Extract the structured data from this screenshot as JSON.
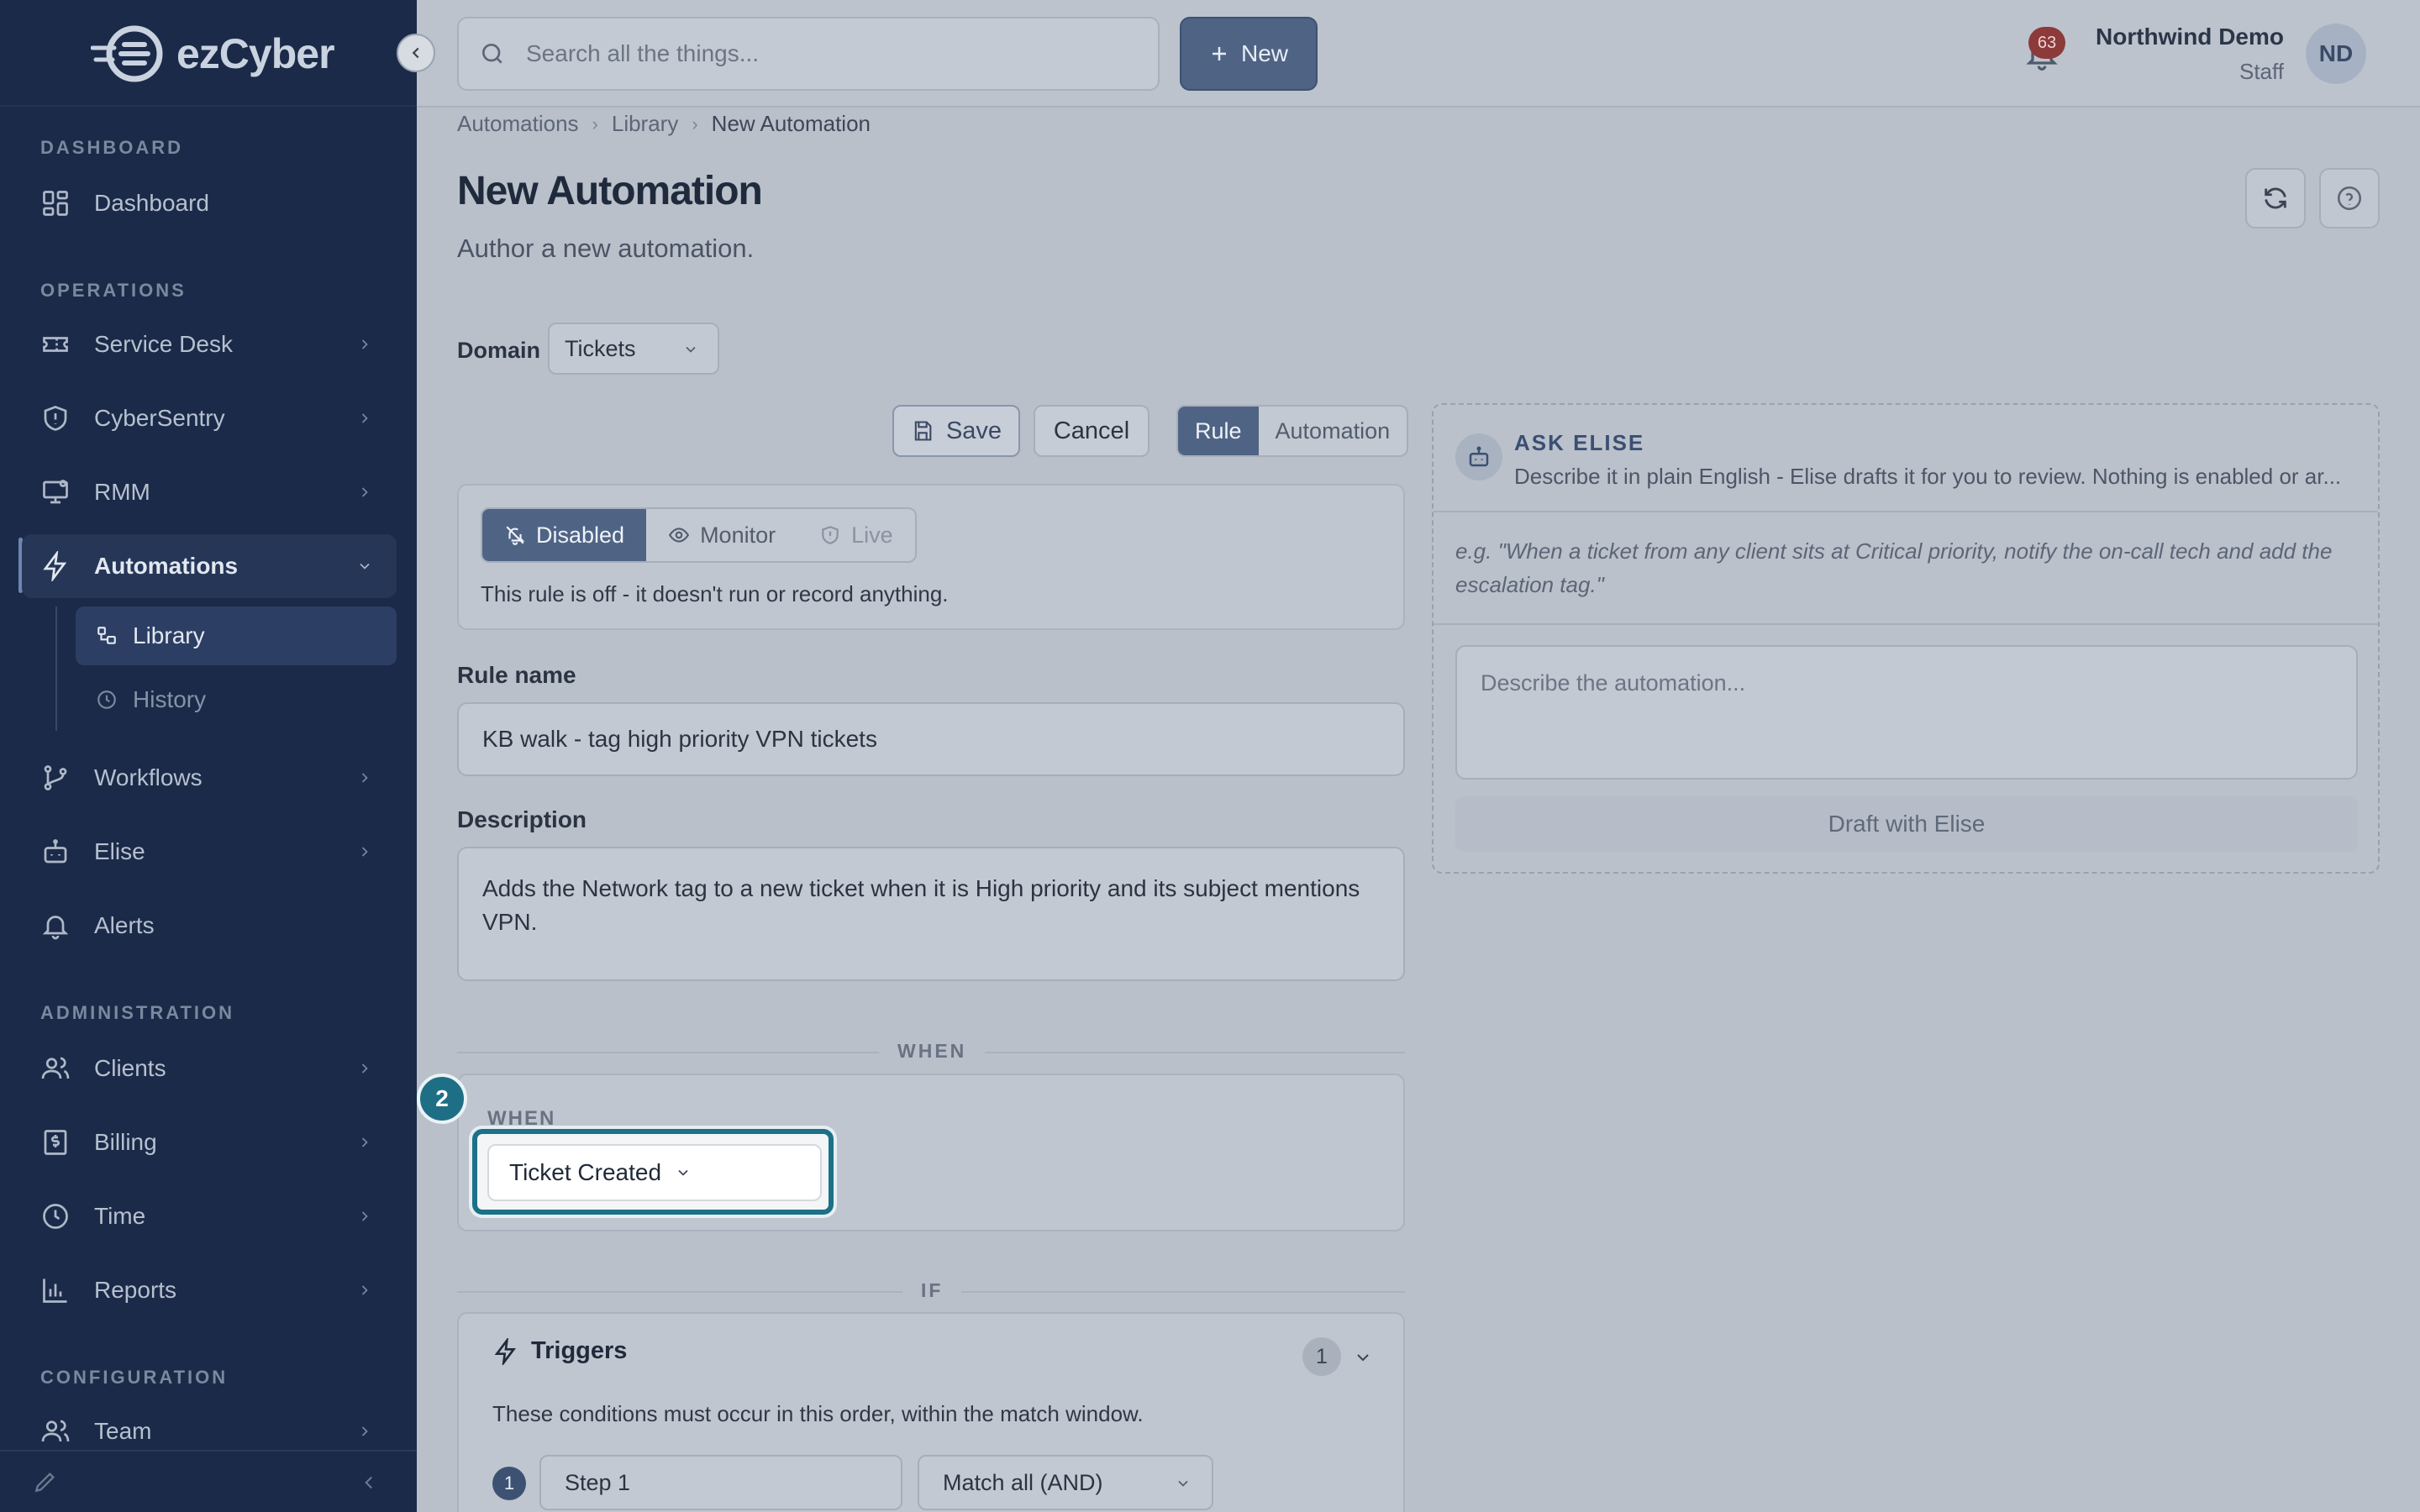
{
  "app": {
    "logo_text": "ezCyber"
  },
  "sidebar": {
    "sections": {
      "dashboard": "DASHBOARD",
      "operations": "OPERATIONS",
      "administration": "ADMINISTRATION",
      "configuration": "CONFIGURATION"
    },
    "items": {
      "dashboard": "Dashboard",
      "service_desk": "Service Desk",
      "cybersentry": "CyberSentry",
      "rmm": "RMM",
      "automations": "Automations",
      "library": "Library",
      "history": "History",
      "workflows": "Workflows",
      "elise": "Elise",
      "alerts": "Alerts",
      "clients": "Clients",
      "billing": "Billing",
      "time": "Time",
      "reports": "Reports",
      "team": "Team"
    }
  },
  "topbar": {
    "search_placeholder": "Search all the things...",
    "new_label": "New",
    "notification_count": "63",
    "user_name": "Northwind Demo",
    "user_role": "Staff",
    "avatar_initials": "ND"
  },
  "breadcrumb": [
    "Automations",
    "Library",
    "New Automation"
  ],
  "page": {
    "title": "New Automation",
    "subtitle": "Author a new automation."
  },
  "form": {
    "domain_label": "Domain",
    "domain_value": "Tickets",
    "save_label": "Save",
    "cancel_label": "Cancel",
    "type_options": [
      "Rule",
      "Automation"
    ],
    "type_selected": "Rule",
    "mode_options": [
      "Disabled",
      "Monitor",
      "Live"
    ],
    "mode_selected": "Disabled",
    "mode_note": "This rule is off - it doesn't run or record anything.",
    "rule_name_label": "Rule name",
    "rule_name_value": "KB walk - tag high priority VPN tickets",
    "description_label": "Description",
    "description_value": "Adds the Network tag to a new ticket when it is High priority and its subject mentions VPN.",
    "when_divider": "WHEN",
    "when_label": "WHEN",
    "when_trigger": "Ticket Created",
    "step_marker": "2",
    "if_divider": "IF",
    "triggers_title": "Triggers",
    "triggers_count": "1",
    "triggers_note": "These conditions must occur in this order, within the match window.",
    "step_number": "1",
    "step_name": "Step 1",
    "match_mode": "Match all (AND)"
  },
  "elise": {
    "title": "ASK ELISE",
    "description": "Describe it in plain English - Elise drafts it for you to review. Nothing is enabled or ar...",
    "example": "e.g. \"When a ticket from any client sits at Critical priority, notify the on-call tech and add the escalation tag.\"",
    "input_placeholder": "Describe the automation...",
    "draft_label": "Draft with Elise"
  },
  "colors": {
    "sidebar_bg": "#1b2a48",
    "accent": "#4f6485",
    "highlight": "#1c7188",
    "badge": "#8c3a3a"
  }
}
